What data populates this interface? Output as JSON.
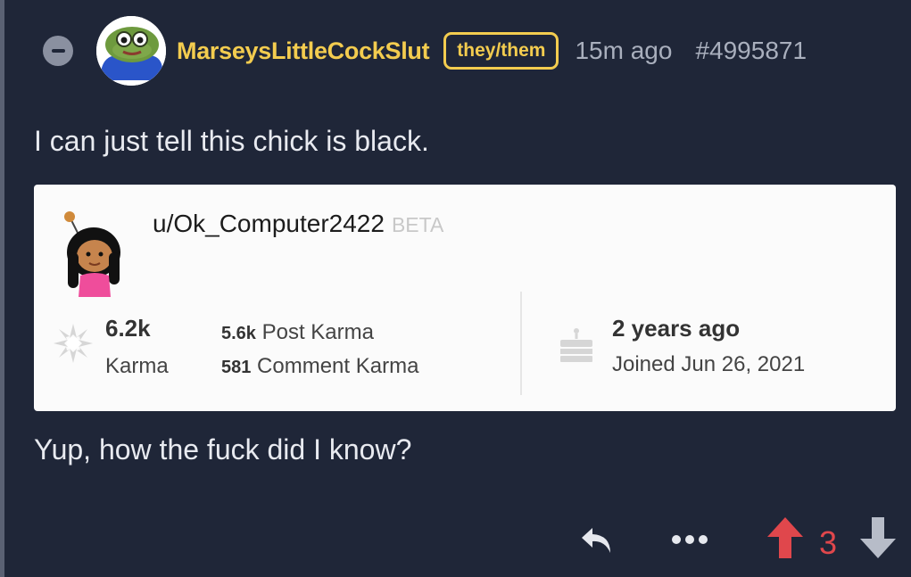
{
  "comment": {
    "username": "MarseysLittleCockSlut",
    "pronouns": "they/them",
    "time": "15m ago",
    "comment_id": "#4995871",
    "text_before": "I can just tell this chick is black.",
    "text_after": "Yup, how the fuck did I know?",
    "score": "3"
  },
  "embed": {
    "username": "u/Ok_Computer2422",
    "beta": "BETA",
    "karma_value": "6.2k",
    "karma_label": "Karma",
    "post_karma_value": "5.6k",
    "post_karma_label": "Post Karma",
    "comment_karma_value": "581",
    "comment_karma_label": "Comment Karma",
    "age_value": "2 years ago",
    "joined_label": "Joined Jun 26, 2021"
  },
  "icons": {
    "collapse": "minus-circle-icon",
    "reply": "reply-arrow-icon",
    "more": "more-dots-icon",
    "upvote": "upvote-arrow-icon",
    "downvote": "downvote-arrow-icon",
    "karma": "karma-star-icon",
    "cake": "cake-icon"
  },
  "colors": {
    "background": "#1f2638",
    "username": "#f3cc4f",
    "upvote": "#e0474c",
    "muted": "#a9afbd"
  }
}
